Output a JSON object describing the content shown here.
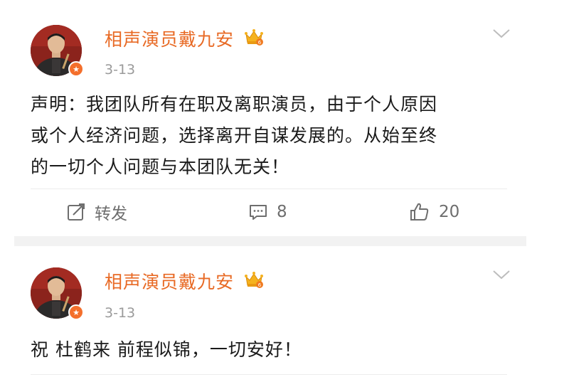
{
  "colors": {
    "username": "#e86a25",
    "badge": "#f46f2c",
    "meta": "#9a9a9a",
    "text": "#1a1a1a",
    "action": "#6e6e6e",
    "separator": "#f2f2f2"
  },
  "posts": [
    {
      "username": "相声演员戴九安",
      "badge_icon": "verified-v-icon",
      "rank_icon": "crown-badge-icon",
      "timestamp": "3-13",
      "content": "声明：我团队所有在职及离职演员，由于个人原因\n或个人经济问题，选择离开自谋发展的。从始至终\n的一切个人问题与本团队无关！",
      "actions": {
        "repost_label": "转发",
        "comment_count": "8",
        "like_count": "20"
      }
    },
    {
      "username": "相声演员戴九安",
      "badge_icon": "verified-v-icon",
      "rank_icon": "crown-badge-icon",
      "timestamp": "3-13",
      "content": "祝 杜鹤来 前程似锦，一切安好！"
    }
  ]
}
